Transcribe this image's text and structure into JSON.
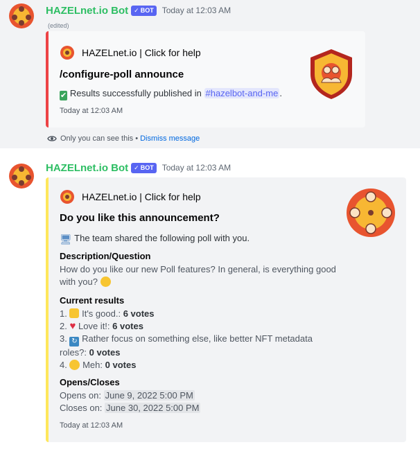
{
  "colors": {
    "username": "#2dbe63",
    "bot_tag": "#5865f2",
    "embed_red": "#ed4245",
    "embed_yellow": "#fee75c",
    "link": "#0068e0"
  },
  "message1": {
    "username": "HAZELnet.io Bot",
    "bot_tag": "BOT",
    "timestamp": "Today at 12:03 AM",
    "edited": "(edited)",
    "embed": {
      "author": "HAZELnet.io | Click for help",
      "title": "/configure-poll announce",
      "body_prefix": "Results successfully published in",
      "channel": "#hazelbot-and-me",
      "body_suffix": ".",
      "footer": "Today at 12:03 AM"
    },
    "ephemeral": {
      "text": "Only you can see this •",
      "dismiss": "Dismiss message"
    }
  },
  "message2": {
    "username": "HAZELnet.io Bot",
    "bot_tag": "BOT",
    "timestamp": "Today at 12:03 AM",
    "embed": {
      "author": "HAZELnet.io | Click for help",
      "title": "Do you like this announcement?",
      "intro": "The team shared the following poll with you.",
      "desc_title": "Description/Question",
      "desc_line1": "How do you like our new Poll features? In general, is everything good",
      "desc_line2": "with you?",
      "results_title": "Current results",
      "results": [
        {
          "prefix": "1.",
          "label": "It's good.:",
          "votes": "6 votes"
        },
        {
          "prefix": "2.",
          "label": "Love it!:",
          "votes": "6 votes"
        },
        {
          "prefix": "3.",
          "label": "Rather focus on something else, like better NFT metadata",
          "label2": "roles?:",
          "votes": "0 votes"
        },
        {
          "prefix": "4.",
          "label": "Meh:",
          "votes": "0 votes"
        }
      ],
      "opens_title": "Opens/Closes",
      "opens_label": "Opens on:",
      "opens_value": "June 9, 2022 5:00 PM",
      "closes_label": "Closes on:",
      "closes_value": "June 30, 2022 5:00 PM",
      "footer": "Today at 12:03 AM"
    }
  }
}
